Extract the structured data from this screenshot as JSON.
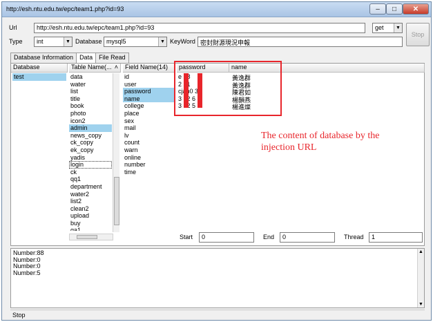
{
  "window": {
    "title": "http://esh.ntu.edu.tw/epc/team1.php?id=93",
    "min_icon": "minimize-icon",
    "max_icon": "maximize-icon",
    "close_icon": "close-icon"
  },
  "form": {
    "url_label": "Url",
    "url_value": "http://esh.ntu.edu.tw/epc/team1.php?id=93",
    "method": "get",
    "type_label": "Type",
    "type_value": "int",
    "database_label": "Database",
    "database_value": "mysql5",
    "keyword_label": "KeyWord",
    "keyword_value": "密封財源現況申報",
    "stop_label": "Stop"
  },
  "tabs": [
    "Database Information",
    "Data",
    "File Read"
  ],
  "columns": {
    "database": "Database",
    "table": "Table Name(...",
    "field": "Field Name(14)",
    "password": "password",
    "name": "name"
  },
  "databases": [
    "test"
  ],
  "tables": [
    "data",
    "water",
    "list",
    "title",
    "book",
    "photo",
    "icon2",
    "admin",
    "news_copy",
    "ck_copy",
    "ek_copy",
    "yadis",
    "login",
    "ck",
    "qq1",
    "department",
    "water2",
    "list2",
    "clean2",
    "upload",
    "buy",
    "qa1"
  ],
  "fields": [
    "id",
    "user",
    "password",
    "name",
    "college",
    "place",
    "sex",
    "mail",
    "lv",
    "count",
    "warn",
    "online",
    "number",
    "time"
  ],
  "results": [
    {
      "password": "e  28",
      "name": "黃逸群"
    },
    {
      "password": "2  21",
      "name": "黃逸群"
    },
    {
      "password": "cjan0  3",
      "name": "陳君如"
    },
    {
      "password": "3  62  6",
      "name": "楊韻燕"
    },
    {
      "password": "3  62  5",
      "name": "楊進燦"
    }
  ],
  "annotation": {
    "line1": "The content of database by the",
    "line2": "injection URL"
  },
  "range": {
    "start_label": "Start",
    "start_value": "0",
    "end_label": "End",
    "end_value": "0",
    "thread_label": "Thread",
    "thread_value": "1"
  },
  "log_lines": [
    "Number:88",
    "Number:0",
    "Number:0",
    "Number:5"
  ],
  "status": "Stop",
  "colors": {
    "selection": "#3399ff",
    "highlight": "#9fd2ee",
    "annotation_red": "#e8252b"
  }
}
